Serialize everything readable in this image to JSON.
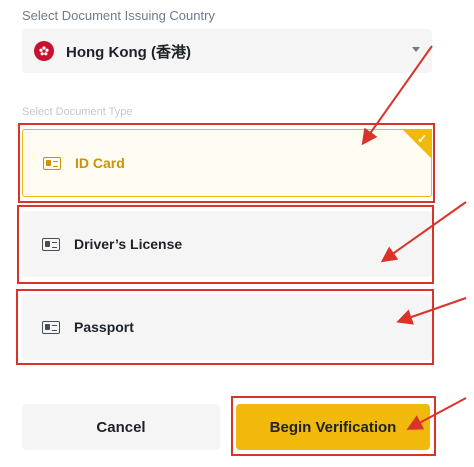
{
  "country_section": {
    "label": "Select Document Issuing Country",
    "selected_country": "Hong Kong (香港)",
    "flag_icon": "hong-kong-flag-icon"
  },
  "document_type_section": {
    "label": "Select Document Type",
    "options": [
      {
        "label": "ID Card",
        "selected": true,
        "icon": "id-card-icon"
      },
      {
        "label": "Driver’s License",
        "selected": false,
        "icon": "license-card-icon"
      },
      {
        "label": "Passport",
        "selected": false,
        "icon": "passport-card-icon"
      }
    ]
  },
  "actions": {
    "cancel_label": "Cancel",
    "begin_label": "Begin Verification"
  },
  "colors": {
    "accent": "#f0b90b",
    "accent_text": "#c99400",
    "annotation_red": "#d9332a",
    "panel_bg": "#f5f5f5"
  }
}
